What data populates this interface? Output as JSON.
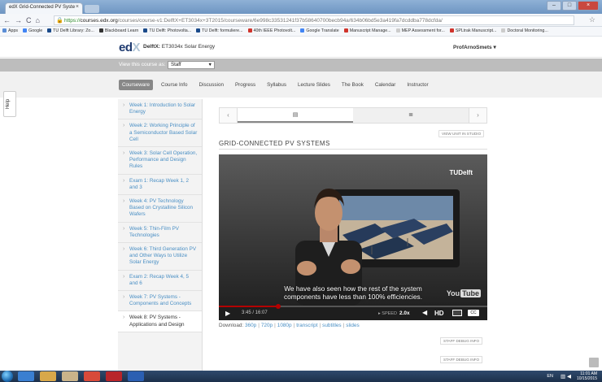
{
  "browser": {
    "tab_title": "edX Grid-Connected PV Syste",
    "tab_close": "×",
    "window_controls": [
      "–",
      "□",
      "×"
    ],
    "url_scheme": "https://",
    "url_host": "courses.edx.org",
    "url_path": "/courses/course-v1:DelftX+ET3034x+3T2015/courseware/6e998c33531241f37b58640700becb94a/634b06bd5e3a419fa7dcddba778dcfda/",
    "bookmarks": [
      {
        "label": "Apps",
        "color": "#5b8ed6"
      },
      {
        "label": "Google",
        "color": "#4285f4"
      },
      {
        "label": "TU Delft Library: Zo...",
        "color": "#1a4a8a"
      },
      {
        "label": "Blackboard Learn",
        "color": "#333333"
      },
      {
        "label": "TU Delft: Photovolta...",
        "color": "#1a4a8a"
      },
      {
        "label": "TU Delft: formuliere...",
        "color": "#1a4a8a"
      },
      {
        "label": "40th IEEE Photovolt...",
        "color": "#d0342c"
      },
      {
        "label": "Google Translate",
        "color": "#4285f4"
      },
      {
        "label": "Manuscript Manage...",
        "color": "#d0342c"
      },
      {
        "label": "MEP Assessment for...",
        "color": "#cccccc"
      },
      {
        "label": "SPLtrak Manuscript...",
        "color": "#d0342c"
      },
      {
        "label": "Doctoral Monitoring...",
        "color": "#cccccc"
      }
    ]
  },
  "header": {
    "logo_main": "ed",
    "logo_x": "X",
    "course_org": "DelftX:",
    "course_name": "ET3034x Solar Energy",
    "username": "ProfArnoSmets",
    "username_caret": "▾"
  },
  "viewbar": {
    "label": "View this course as:",
    "selected": "Staff"
  },
  "tabs": [
    {
      "label": "Courseware",
      "active": true
    },
    {
      "label": "Course Info",
      "active": false
    },
    {
      "label": "Discussion",
      "active": false
    },
    {
      "label": "Progress",
      "active": false
    },
    {
      "label": "Syllabus",
      "active": false
    },
    {
      "label": "Lecture Slides",
      "active": false
    },
    {
      "label": "The Book",
      "active": false
    },
    {
      "label": "Calendar",
      "active": false
    },
    {
      "label": "Instructor",
      "active": false
    }
  ],
  "help_label": "Help",
  "sidebar": {
    "weeks": [
      "Week 1: Introduction to Solar Energy",
      "Week 2: Working Principle of a Semiconductor Based Solar Cell",
      "Week 3: Solar Cell Operation, Performance and Design Rules",
      "Exam 1: Recap Week 1, 2 and 3",
      "Week 4: PV Technology Based on Crystalline Silicon Wafers",
      "Week 5: Thin-Film PV Technologies",
      "Week 6: Third Generation PV and Other Ways to Utilize Solar Energy",
      "Exam 2: Recap Week 4, 5 and 6",
      "Week 7: PV Systems - Components and Concepts",
      "Week 8: PV Systems - Applications and Design"
    ]
  },
  "sequence": {
    "prev": "‹",
    "next": "›",
    "item1_icon": "▤",
    "item2_icon": "≣"
  },
  "unit": {
    "view_in_studio": "VIEW UNIT IN STUDIO",
    "title": "GRID-CONNECTED PV SYSTEMS"
  },
  "video": {
    "brand": "TUDelft",
    "subtitle_line1": "We have also seen how the rest of the system",
    "subtitle_line2": "components have less than 100% efficiencies.",
    "youtube_you": "You",
    "youtube_tube": "Tube",
    "progress": 0.22,
    "play": "▶",
    "time": "3:45 / 16:07",
    "speed_label": "SPEED",
    "speed_value": "2.0x",
    "volume": "◀",
    "hd": "HD",
    "cc": "CC"
  },
  "downloads": {
    "label": "Download:",
    "links": [
      "360p",
      "720p",
      "1080p",
      "transcript",
      "subtitles",
      "slides"
    ]
  },
  "debug": {
    "button1": "STAFF DEBUG INFO",
    "button2": "STAFF DEBUG INFO"
  },
  "taskbar": {
    "apps": [
      {
        "name": "ie-icon",
        "color": "#3a7fd1"
      },
      {
        "name": "explorer-icon",
        "color": "#d8a84a"
      },
      {
        "name": "libraries-icon",
        "color": "#c9b38a"
      },
      {
        "name": "chrome-icon",
        "color": "#d84a3a"
      },
      {
        "name": "acrobat-icon",
        "color": "#b8252a"
      },
      {
        "name": "word-icon",
        "color": "#2b5fb2"
      }
    ],
    "lang": "EN",
    "time": "11:01 AM",
    "date": "10/15/2015"
  }
}
